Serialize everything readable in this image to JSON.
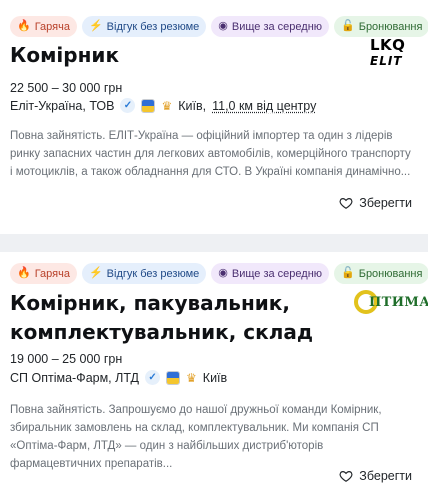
{
  "jobs": [
    {
      "badges": {
        "hot": "Гаряча",
        "quick": "Відгук без резюме",
        "salary": "Вище за середню",
        "reservation": "Бронювання"
      },
      "title": "Комірник",
      "salary": "22 500 – 30 000 грн",
      "company": "Еліт-Україна, ТОВ",
      "city": "Київ,",
      "distance": "11,0 км від центру",
      "description": "Повна зайнятість. ЕЛІТ-Україна — офіційний імпортер та один з лідерів ринку запасних частин для легкових автомобілів, комерційного транспорту і мотоциклів, а також обладнання для СТО. В Україні компанія динамічно...",
      "save_label": "Зберегти",
      "logo": {
        "line1": "LKQ",
        "line2": "ELIT"
      }
    },
    {
      "badges": {
        "hot": "Гаряча",
        "quick": "Відгук без резюме",
        "salary": "Вище за середню",
        "reservation": "Бронювання"
      },
      "title_line1": "Комірник, пакувальник,",
      "title_line2": "комплектувальник, склад",
      "salary": "19 000 – 25 000 грн",
      "company": "СП Оптіма-Фарм, ЛТД",
      "city": "Київ",
      "description": "Повна зайнятість. Запрошуємо до нашої дружньої команди Комірник, збиральник замовлень на склад, комплектувальник. Ми компанія СП «Оптіма-Фарм, ЛТД» — один з найбільших дистриб'юторів фармацевтичних препаратів...",
      "save_label": "Зберегти",
      "logo": {
        "text": "ПТИМА"
      }
    }
  ],
  "icons": {
    "hot": "fire-icon",
    "quick": "lightning-icon",
    "salary": "coin-icon",
    "reservation": "lock-icon",
    "verified": "check-icon",
    "flag": "ukraine-flag-icon",
    "premium": "crown-icon",
    "save": "heart-icon"
  },
  "colors": {
    "hot_bg": "#fde8e4",
    "blue_bg": "#e5effc",
    "purple_bg": "#f1e8fb",
    "green_bg": "#e6f5e7"
  }
}
